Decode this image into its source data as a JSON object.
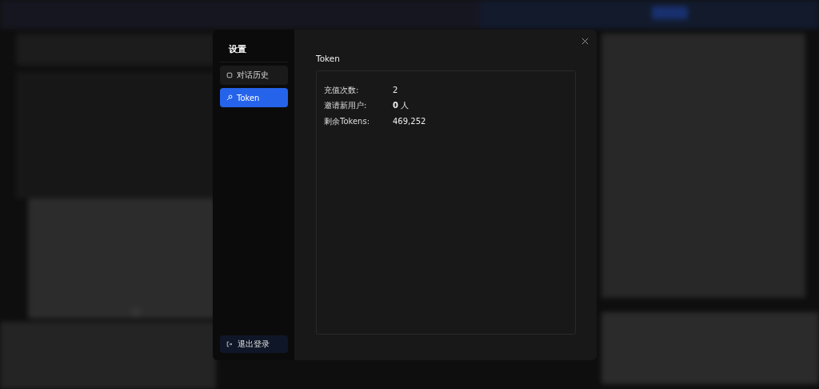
{
  "settings_dialog": {
    "title": "设置",
    "nav_items": [
      {
        "label": "对话历史",
        "kind": "history",
        "selected": false
      },
      {
        "label": "Token",
        "kind": "token",
        "selected": true
      }
    ],
    "logout_button": "退出登录",
    "section_title": "Token",
    "stats": [
      {
        "label": "充值次数:",
        "value": "2"
      },
      {
        "label": "邀请新用户:",
        "value": "**0** 人"
      },
      {
        "label": "剩余Tokens:",
        "value": "469,252"
      }
    ]
  }
}
